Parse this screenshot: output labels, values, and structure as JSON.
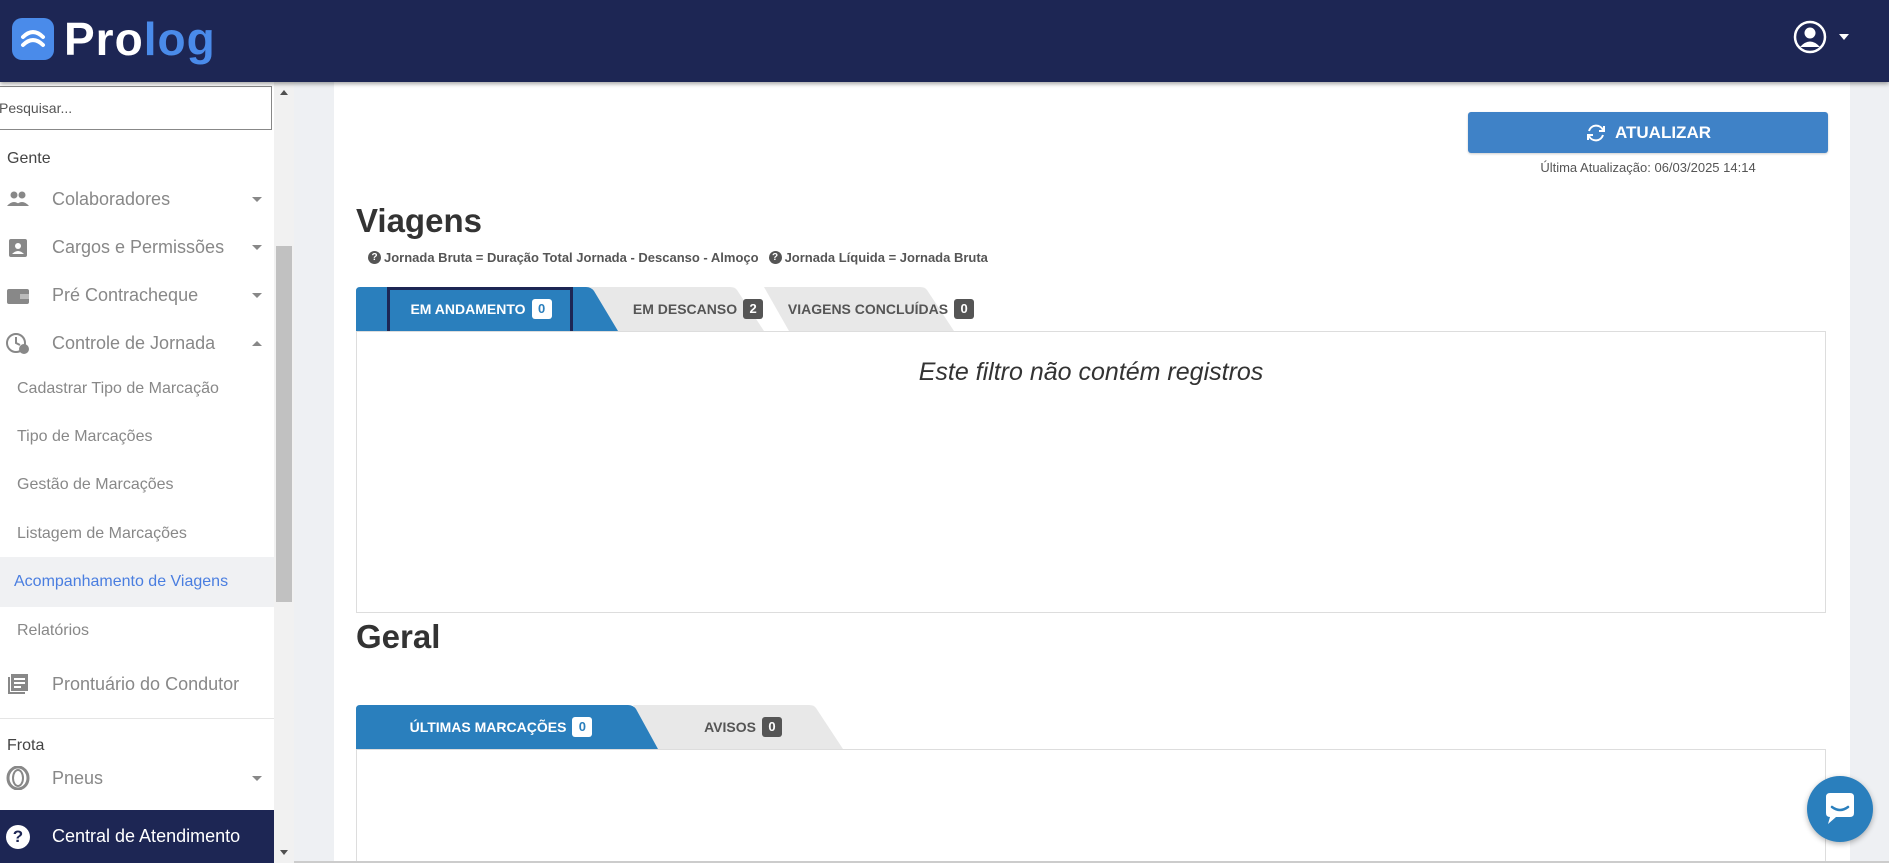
{
  "app": {
    "logo_pro": "Pro",
    "logo_log": "log"
  },
  "sidebar": {
    "search_placeholder": "Pesquisar...",
    "section_gente": "Gente",
    "items": [
      {
        "label": "Colaboradores",
        "icon": "people-icon"
      },
      {
        "label": "Cargos e Permissões",
        "icon": "badge-icon"
      },
      {
        "label": "Pré Contracheque",
        "icon": "wallet-icon"
      },
      {
        "label": "Controle de Jornada",
        "icon": "clock-icon"
      }
    ],
    "subitems": [
      "Cadastrar Tipo de Marcação",
      "Tipo de Marcações",
      "Gestão de Marcações",
      "Listagem de Marcações",
      "Acompanhamento de Viagens",
      "Relatórios"
    ],
    "prontuario": "Prontuário do Condutor",
    "section_frota": "Frota",
    "pneus": "Pneus",
    "support": "Central de Atendimento"
  },
  "main": {
    "refresh_label": "ATUALIZAR",
    "last_update": "Última Atualização: 06/03/2025 14:14",
    "viagens_title": "Viagens",
    "legend_bruta": "Jornada Bruta = Duração Total Jornada - Descanso - Almoço",
    "legend_liquida": "Jornada Líquida = Jornada Bruta",
    "viagens_tabs": [
      {
        "label": "EM ANDAMENTO",
        "count": "0"
      },
      {
        "label": "EM DESCANSO",
        "count": "2"
      },
      {
        "label": "VIAGENS CONCLUÍDAS",
        "count": "0"
      }
    ],
    "empty_message": "Este filtro não contém registros",
    "geral_title": "Geral",
    "geral_tabs": [
      {
        "label": "ÚLTIMAS MARCAÇÕES",
        "count": "0"
      },
      {
        "label": "AVISOS",
        "count": "0"
      }
    ]
  },
  "colors": {
    "navy": "#1d2654",
    "accent_blue": "#2a7fbd",
    "button_blue": "#3f82c7",
    "active_link": "#4a7ee0"
  }
}
